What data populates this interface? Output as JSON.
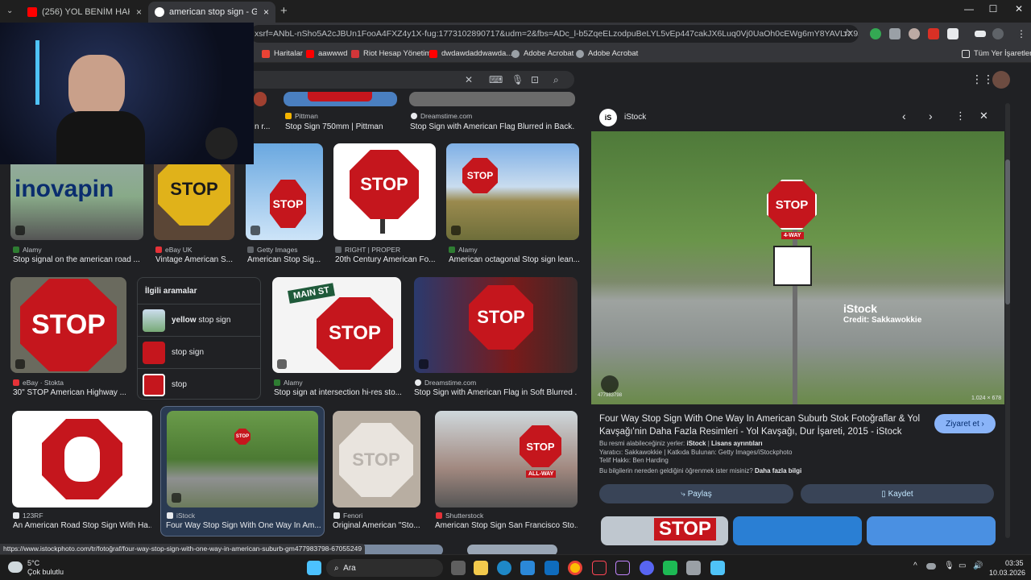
{
  "tabs": [
    {
      "title": "(256) YOL BENİM HAKKIM | SS",
      "close": "×"
    },
    {
      "title": "american stop sign - Google'da",
      "close": "×"
    }
  ],
  "new_tab": "+",
  "window_controls": {
    "minimize": "—",
    "maximize": "☐",
    "close": "✕"
  },
  "address_bar": {
    "url": "xsrf=ANbL-nSho5A2cJBUn1FooA4FXZ4y1X-fug:1773102890717&udm=2&fbs=ADc_l-b5ZqeELzodpuBeLYL5vEp447cakJX6Luq0Vj0UaOh0cEWg6mY8YAVLrX934EJhmqzFndEJGD..."
  },
  "bookmarks": [
    {
      "label": "Haritalar",
      "color": "#ea4335"
    },
    {
      "label": "aawwwd",
      "color": "#ff0000"
    },
    {
      "label": "Riot Hesap Yönetimi",
      "color": "#d13639"
    },
    {
      "label": "dwdawdaddwawda...",
      "color": "#ff0000"
    },
    {
      "label": "Adobe Acrobat",
      "color": "#9aa0a6"
    },
    {
      "label": "Adobe Acrobat",
      "color": "#9aa0a6"
    }
  ],
  "all_bookmarks": "Tüm Yer İşaretleri",
  "results_top": [
    {
      "source": "Pittman",
      "title": "Stop Sign 750mm | Pittman"
    },
    {
      "source": "Dreamstime.com",
      "title": "Stop Sign with American Flag Blurred in Back..."
    }
  ],
  "row1_partial_title": "n r...",
  "results_row1": [
    {
      "source": "Alamy",
      "title": "Stop signal on the american road ...",
      "thumb_text": "inovapin",
      "source_color": "#2e7d32"
    },
    {
      "source": "eBay UK",
      "title": "Vintage American S...",
      "thumb_text": "STOP",
      "source_color": "#e53238"
    },
    {
      "source": "Getty Images",
      "title": "American Stop Sig...",
      "thumb_text": "STOP",
      "source_color": "#5f6368"
    },
    {
      "source": "RIGHT | PROPER",
      "title": "20th Century American Fo...",
      "thumb_text": "STOP",
      "source_color": "#5f6368"
    },
    {
      "source": "Alamy",
      "title": "American octagonal Stop sign lean...",
      "thumb_text": "STOP",
      "source_color": "#2e7d32"
    }
  ],
  "related": {
    "title": "İlgili aramalar",
    "items": [
      {
        "bold": "yellow",
        "rest": " stop sign"
      },
      {
        "bold": "",
        "rest": "stop sign"
      },
      {
        "bold": "",
        "rest": "stop"
      }
    ]
  },
  "results_row2": [
    {
      "source": "eBay · Stokta",
      "title": "30\" STOP American Highway ...",
      "thumb_text": "STOP"
    },
    {
      "source": "Alamy",
      "title": "Stop sign at intersection hi-res sto...",
      "thumb_text": "STOP",
      "street": "MAIN ST"
    },
    {
      "source": "Dreamstime.com",
      "title": "Stop Sign with American Flag in Soft Blurred ...",
      "thumb_text": "STOP"
    }
  ],
  "results_row3": [
    {
      "source": "123RF",
      "title": "An American Road Stop Sign With Ha..."
    },
    {
      "source": "iStock",
      "title": "Four Way Stop Sign With One Way In Am..."
    },
    {
      "source": "Fenori",
      "title": "Original American \"Sto...",
      "thumb_text": "STOP"
    },
    {
      "source": "Shutterstock",
      "title": "American Stop Sign San Francisco Sto...",
      "thumb_text": "STOP",
      "sub_text": "ALL-WAY"
    }
  ],
  "panel": {
    "source": "iStock",
    "source_logo": "iS",
    "image_watermark": "iStock",
    "image_credit": "Credit: Sakkawokkie",
    "image_stop": "STOP",
    "image_4way": "4-WAY",
    "image_dims": "1.024 × 678",
    "image_id": "477983798",
    "title": "Four Way Stop Sign With One Way In American Suburb Stok Fotoğraflar & Yol Kavşağı'nin Daha Fazla Resimleri - Yol Kavşağı, Dur İşareti, 2015 - iStock",
    "visit_button": "Ziyaret et",
    "license_prefix": "Bu resmi alabileceğiniz yerler: ",
    "license_source": "iStock",
    "license_link": "Lisans ayrıntıları",
    "creator_line": "Yaratıcı: Sakkawokkie | Katkıda Bulunan: Getty Images/iStockphoto",
    "copyright_line": "Telif Hakkı: Ben Harding",
    "learn_prefix": "Bu bilgilerin nereden geldiğini öğrenmek ister misiniz? ",
    "learn_link": "Daha fazla bilgi",
    "share_button": "Paylaş",
    "save_button": "Kaydet",
    "more_stop": "STOP"
  },
  "status_url": "https://www.istockphoto.com/tr/fotoğraf/four-way-stop-sign-with-one-way-in-american-suburb-gm477983798-67055249",
  "taskbar": {
    "weather_temp": "5°C",
    "weather_desc": "Çok bulutlu",
    "search_label": "Ara",
    "time": "03:35",
    "date": "10.03.2026"
  }
}
